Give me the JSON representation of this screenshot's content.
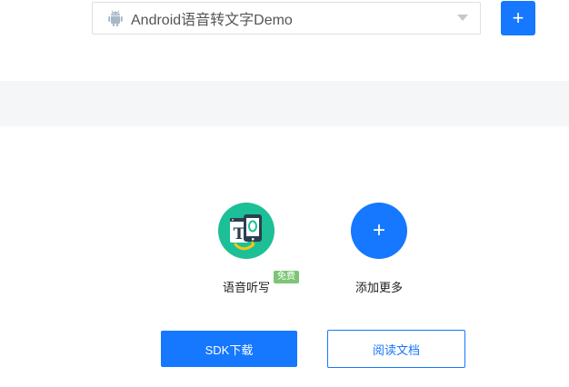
{
  "app_select": {
    "value": "Android语音转文字Demo",
    "icon": "android-icon"
  },
  "add_app": {
    "label": "+"
  },
  "services": [
    {
      "label": "语音听写",
      "badge": "免费",
      "icon": "speech-dictation-icon",
      "color": "#1cbf96"
    },
    {
      "label": "添加更多",
      "icon": "plus-icon",
      "symbol": "+",
      "color": "#1677ff"
    }
  ],
  "actions": {
    "sdk_download": "SDK下载",
    "read_docs": "阅读文档"
  }
}
